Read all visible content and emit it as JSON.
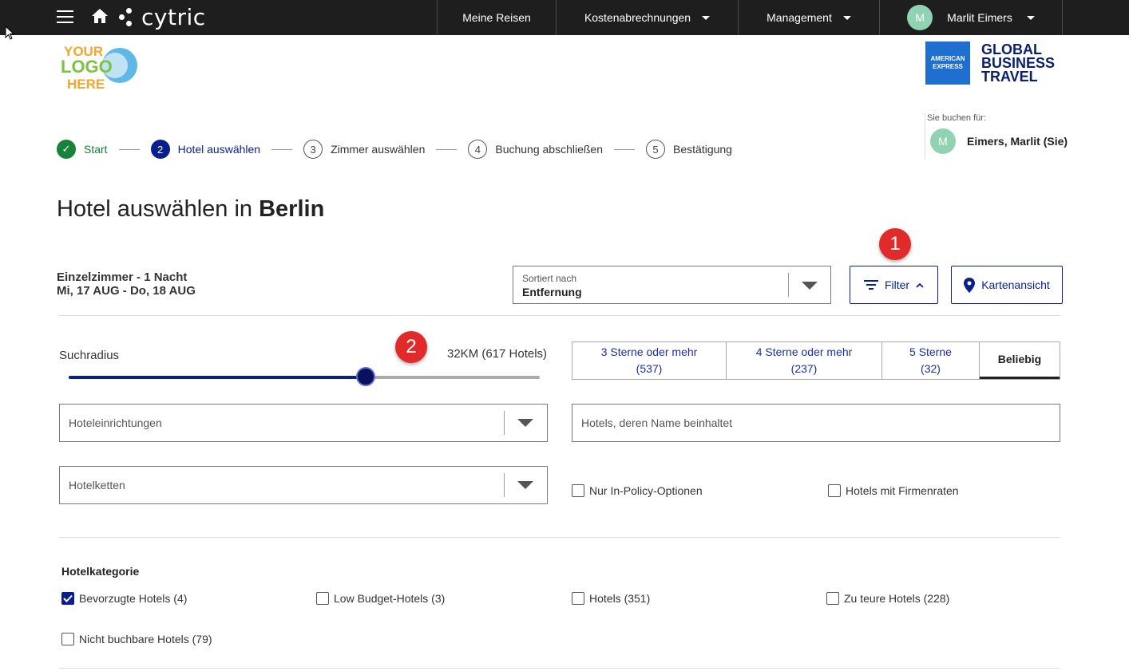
{
  "topbar": {
    "brand": "cytric",
    "nav": [
      {
        "label": "Meine Reisen"
      },
      {
        "label": "Kostenabrechnungen"
      },
      {
        "label": "Management"
      }
    ],
    "user": {
      "initial": "M",
      "name": "Marlit Eimers"
    }
  },
  "logo": {
    "line1": "YOUR",
    "line2": "LOGO",
    "line3": "HERE"
  },
  "amex": {
    "box_line1": "AMERICAN",
    "box_line2": "EXPRESS",
    "gbt_line1": "GLOBAL",
    "gbt_line2": "BUSINESS",
    "gbt_line3": "TRAVEL"
  },
  "booking_for": {
    "label": "Sie buchen für:",
    "initial": "M",
    "name": "Eimers, Marlit (Sie)"
  },
  "steps": [
    {
      "num": "✓",
      "label": "Start",
      "state": "done"
    },
    {
      "num": "2",
      "label": "Hotel auswählen",
      "state": "active"
    },
    {
      "num": "3",
      "label": "Zimmer auswählen",
      "state": "todo"
    },
    {
      "num": "4",
      "label": "Buchung abschließen",
      "state": "todo"
    },
    {
      "num": "5",
      "label": "Bestätigung",
      "state": "todo"
    }
  ],
  "title": {
    "prefix": "Hotel auswählen in ",
    "city": "Berlin"
  },
  "room": {
    "type": "Einzelzimmer - 1 Nacht",
    "dates": "Mi, 17 AUG - Do, 18 AUG"
  },
  "sort": {
    "caption": "Sortiert nach",
    "value": "Entfernung"
  },
  "buttons": {
    "filter": "Filter",
    "map": "Kartenansicht"
  },
  "badges": {
    "one": "1",
    "two": "2"
  },
  "radius": {
    "label": "Suchradius",
    "value": "32KM (617 Hotels)",
    "fraction": 0.63
  },
  "stars": [
    {
      "line1": "3 Sterne oder mehr",
      "line2": "(537)",
      "selected": false
    },
    {
      "line1": "4 Sterne oder mehr",
      "line2": "(237)",
      "selected": false
    },
    {
      "line1": "5 Sterne",
      "line2": "(32)",
      "selected": false
    },
    {
      "line1": "Beliebig",
      "line2": "",
      "selected": true
    }
  ],
  "fields": {
    "amenities": "Hoteleinrichtungen",
    "name_search": "Hotels, deren Name beinhaltet",
    "chains": "Hotelketten"
  },
  "checks": {
    "in_policy": {
      "label": "Nur In-Policy-Optionen",
      "checked": false
    },
    "corporate": {
      "label": "Hotels mit Firmenraten",
      "checked": false
    }
  },
  "category": {
    "title": "Hotelkategorie",
    "items": [
      {
        "label": "Bevorzugte Hotels (4)",
        "checked": true
      },
      {
        "label": "Low Budget-Hotels (3)",
        "checked": false
      },
      {
        "label": "Hotels (351)",
        "checked": false
      },
      {
        "label": "Zu teure Hotels (228)",
        "checked": false
      },
      {
        "label": "Nicht buchbare Hotels (79)",
        "checked": false
      }
    ]
  },
  "colors": {
    "accent": "#0a1f8f",
    "success": "#17833a",
    "badge": "#e12b2b",
    "topbar": "#1e1e1e"
  }
}
